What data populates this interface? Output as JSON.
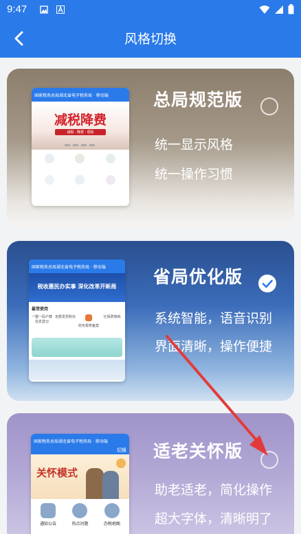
{
  "status_bar": {
    "time": "9:47"
  },
  "app_bar": {
    "title": "风格切换"
  },
  "cards": [
    {
      "title": "总局规范版",
      "desc1": "统一显示风格",
      "desc2": "统一操作习惯",
      "selected": false,
      "thumb_header": "国家税务总局湖北省电子税务局 · 移动端",
      "thumb_banner": "减税降费",
      "thumb_banner_sub": "减税 · 降费 · 便民"
    },
    {
      "title": "省局优化版",
      "desc1": "系统智能，语音识别",
      "desc2": "界面清晰，操作便捷",
      "selected": true,
      "thumb_header": "国家税务总局湖北省电子税务局 · 移动端",
      "thumb_banner": "税收惠民办实事  深化改革开新局",
      "thumb_section": "最常使用",
      "thumb_items": [
        "一键一码户籍信息登记",
        "定额发票购买",
        "财务报表备案",
        "社保费缴纳"
      ]
    },
    {
      "title": "适老关怀版",
      "desc1": "助老适老，简化操作",
      "desc2": "超大字体，清晰明了",
      "selected": false,
      "thumb_header": "国家税务总局湖北省电子税务局 · 移动端",
      "thumb_switch": "切换",
      "thumb_banner": "关怀模式",
      "thumb_items": [
        "通知公告",
        "热点问题",
        "办税地图"
      ]
    }
  ],
  "colors": {
    "primary": "#2a7ae9",
    "arrow": "#e23b3b"
  }
}
